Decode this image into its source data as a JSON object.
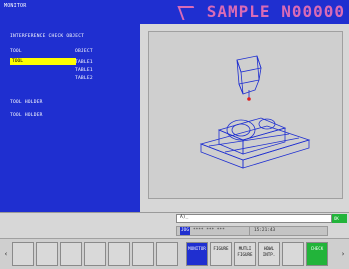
{
  "header": {
    "mode": "MONITOR",
    "program": "SAMPLE N00000"
  },
  "left_panel": {
    "title": "INTERFERENCE CHECK OBJECT",
    "column_tool": "TOOL",
    "column_object": "OBJECT",
    "selected_tool": "TOOL",
    "objects": [
      "TABLE1",
      "TABLE1",
      "TABLE2"
    ],
    "holder_title": "TOOL HOLDER",
    "holder_value": "TOOL HOLDER"
  },
  "input": {
    "prompt": "A)_",
    "ok_label": "OK"
  },
  "status": {
    "mode_cell": "JOG",
    "text_cell": "**** *** ***",
    "time_cell": "15:21:43"
  },
  "softkeys": [
    {
      "label": "MONITOR",
      "state": "active"
    },
    {
      "label": "FIGURE",
      "state": "normal"
    },
    {
      "label": "MUTLI FIGURE",
      "state": "normal"
    },
    {
      "label": "HDWL INTP.",
      "state": "normal"
    },
    {
      "label": "CHECK",
      "state": "green"
    }
  ],
  "colors": {
    "panel_blue": "#1f2fd0",
    "title_pink": "#d96bb6",
    "selection_yellow": "#ffff00",
    "ok_green": "#22b43a"
  }
}
